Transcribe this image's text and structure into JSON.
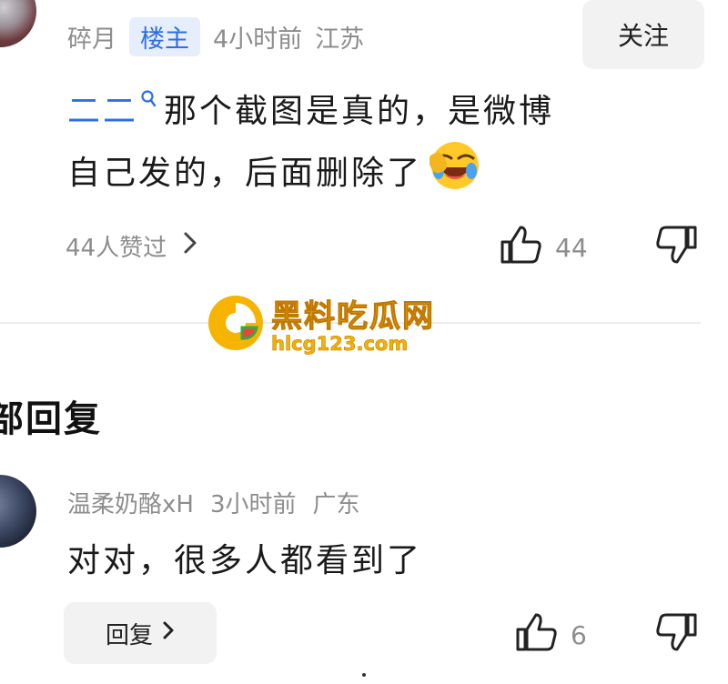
{
  "top_comment": {
    "username": "碎月",
    "badge": "楼主",
    "time": "4小时前",
    "location": "江苏",
    "follow_label": "关注",
    "mention": "二二",
    "text_line1": "那个截图是真的，是微博",
    "text_line2": "自己发的，后面删除了",
    "emoji": "laughing-face-emoji",
    "liked_by": "44人赞过",
    "like_count": "44"
  },
  "watermark": {
    "name": "黑料吃瓜网",
    "url": "hlcg123.com"
  },
  "section_title": "部回复",
  "reply": {
    "username": "温柔奶酪xH",
    "time": "3小时前",
    "location": "广东",
    "text": "对对，很多人都看到了",
    "reply_label": "回复",
    "like_count": "6"
  },
  "icons": {
    "like": "thumbs-up-icon",
    "dislike": "thumbs-down-icon",
    "chevron": "chevron-right-icon",
    "search": "search-icon"
  },
  "colors": {
    "accent_blue": "#2d6fe0",
    "muted": "#8d8d8d",
    "watermark": "#f0b400"
  }
}
